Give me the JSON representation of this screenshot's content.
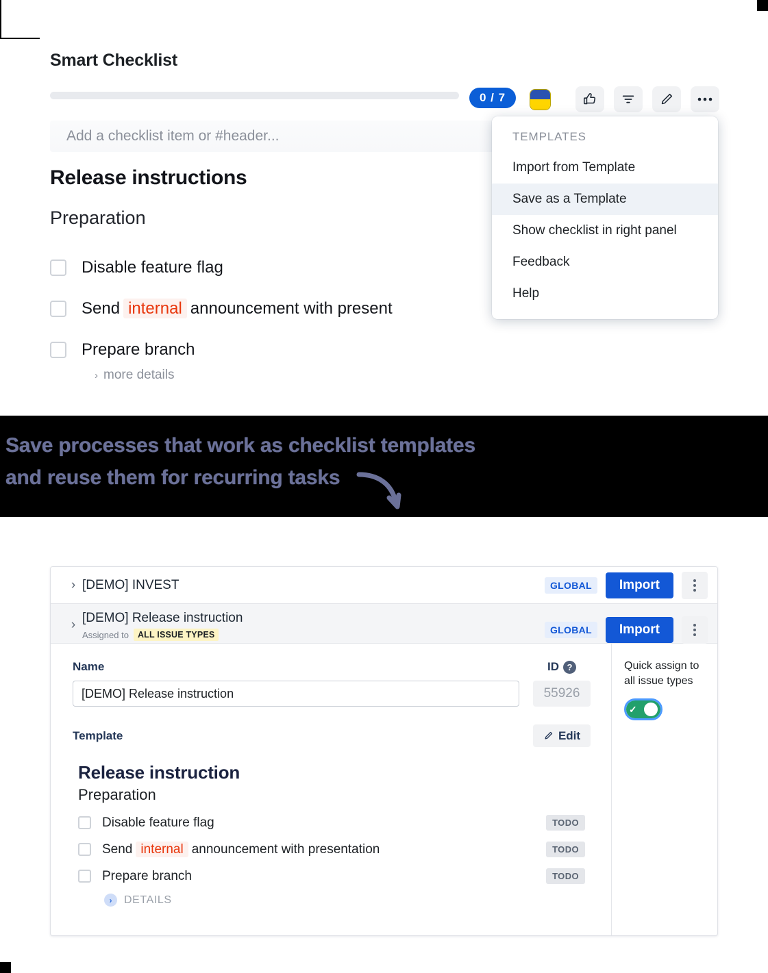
{
  "checklist": {
    "title": "Smart Checklist",
    "progress": {
      "completed": 0,
      "total": 7,
      "label": "0 / 7",
      "percent": 0
    },
    "toolbar": {
      "flag_icon": "ukraine-flag-icon",
      "thumbs_up_icon": "thumbs-up-icon",
      "filter_icon": "filter-icon",
      "edit_icon": "pencil-icon",
      "more_icon": "more-horizontal-icon"
    },
    "add_item_placeholder": "Add a checklist item or #header...",
    "heading": "Release instructions",
    "subheading": "Preparation",
    "items": [
      {
        "label": "Disable feature flag",
        "checked": false
      },
      {
        "label_before": "Send",
        "tag": "internal",
        "label_after": "announcement with present",
        "checked": false
      },
      {
        "label": "Prepare branch",
        "checked": false
      }
    ],
    "more_details": "more details"
  },
  "menu": {
    "header": "TEMPLATES",
    "items": [
      {
        "label": "Import from Template",
        "selected": false
      },
      {
        "label": "Save as a Template",
        "selected": true
      },
      {
        "label": "Show checklist in right panel",
        "selected": false
      },
      {
        "label": "Feedback",
        "selected": false
      },
      {
        "label": "Help",
        "selected": false
      }
    ]
  },
  "banner": {
    "line1": "Save processes that work as checklist templates",
    "line2": "and reuse them for recurring tasks"
  },
  "templates_panel": {
    "rows": [
      {
        "name": "[DEMO] INVEST",
        "scope_badge": "GLOBAL",
        "import_label": "Import",
        "assigned_prefix": "",
        "assigned_badge": ""
      },
      {
        "name": "[DEMO] Release instruction",
        "scope_badge": "GLOBAL",
        "import_label": "Import",
        "assigned_prefix": "Assigned to",
        "assigned_badge": "ALL ISSUE TYPES"
      }
    ],
    "form": {
      "name_label": "Name",
      "name_value": "[DEMO] Release instruction",
      "id_label": "ID",
      "id_value": "55926",
      "template_label": "Template",
      "edit_label": "Edit"
    },
    "preview": {
      "heading": "Release instruction",
      "subheading": "Preparation",
      "items": [
        {
          "label": "Disable feature flag",
          "status": "TODO",
          "checked": false
        },
        {
          "label_before": "Send",
          "tag": "internal",
          "label_after": "announcement with presentation",
          "status": "TODO",
          "checked": false
        },
        {
          "label": "Prepare branch",
          "status": "TODO",
          "checked": false
        }
      ],
      "details_label": "DETAILS"
    },
    "sidebar": {
      "quick_assign_label": "Quick assign to all issue types",
      "toggle_on": true
    }
  },
  "colors": {
    "accent_blue": "#1358d6",
    "badge_blue": "#0b5ed7",
    "tag_red": "#e8360c",
    "toggle_green": "#22a06b",
    "highlight_yellow": "#fdf4c4"
  }
}
